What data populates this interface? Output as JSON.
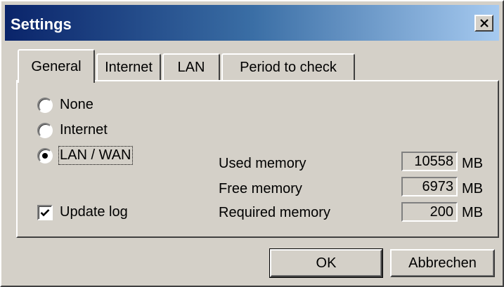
{
  "window": {
    "title": "Settings",
    "colors": {
      "face": "#d4d0c8",
      "title_start": "#0a246a",
      "title_end": "#a6caf0"
    }
  },
  "tabs": [
    {
      "label": "General",
      "active": true
    },
    {
      "label": "Internet",
      "active": false
    },
    {
      "label": "LAN",
      "active": false
    },
    {
      "label": "Period to check",
      "active": false
    }
  ],
  "connection": {
    "options": [
      {
        "label": "None",
        "selected": false
      },
      {
        "label": "Internet",
        "selected": false
      },
      {
        "label": "LAN / WAN",
        "selected": true
      }
    ]
  },
  "update_log": {
    "label": "Update log",
    "checked": true
  },
  "memory": {
    "used": {
      "label": "Used memory",
      "value": "10558",
      "unit": "MB"
    },
    "free": {
      "label": "Free memory",
      "value": "6973",
      "unit": "MB"
    },
    "required": {
      "label": "Required memory",
      "value": "200",
      "unit": "MB"
    }
  },
  "buttons": {
    "ok": "OK",
    "cancel": "Abbrechen"
  },
  "icons": {
    "close": "close-icon",
    "check": "checkmark-icon",
    "radio_dot": "radio-dot"
  }
}
